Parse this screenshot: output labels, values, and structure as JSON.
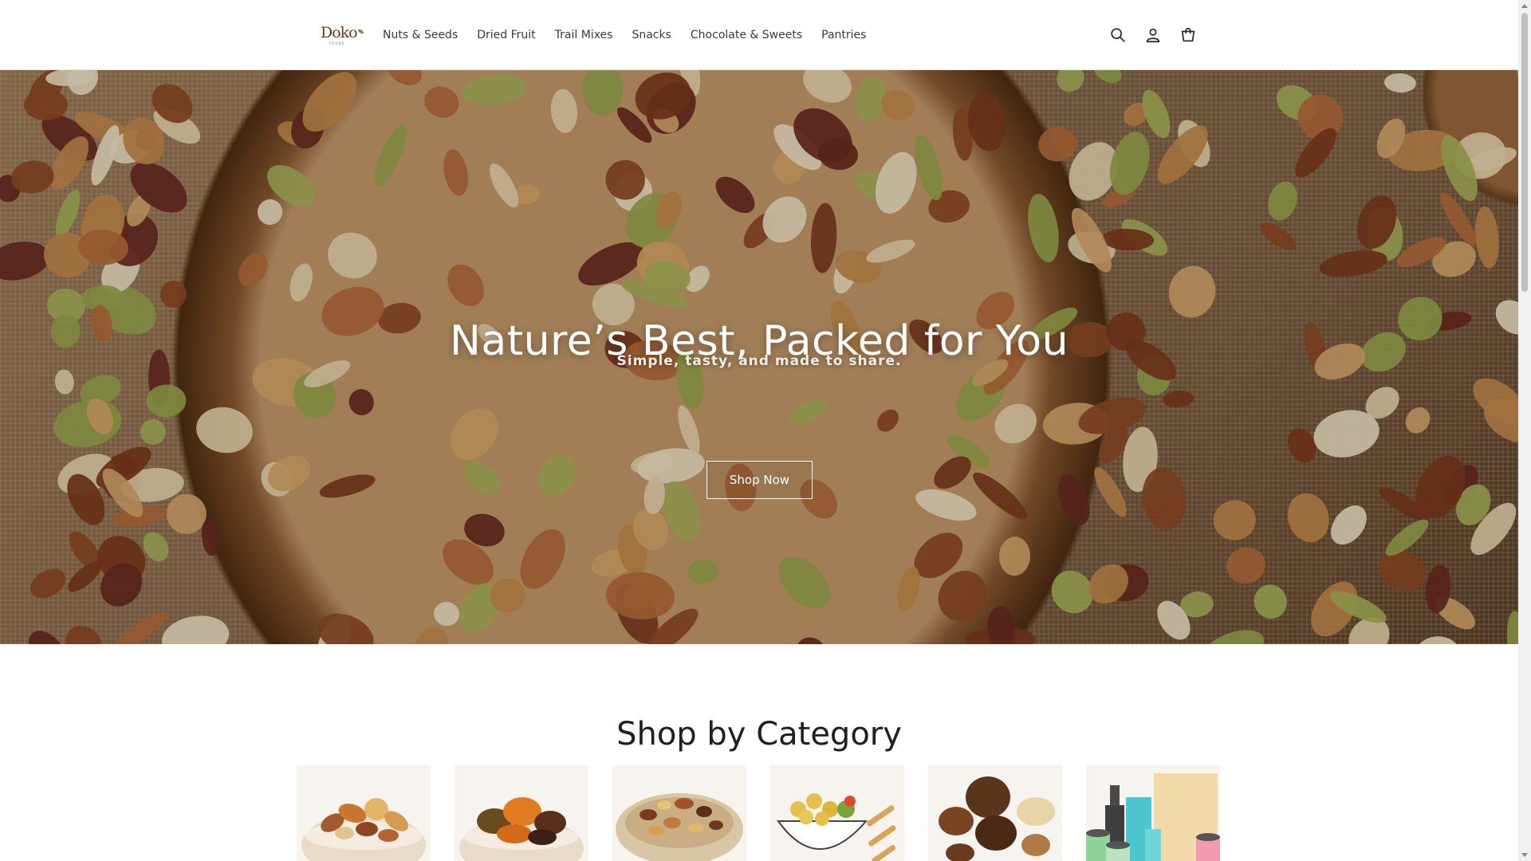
{
  "header": {
    "logo_text_main": "Doko",
    "logo_text_sub": "FOODS",
    "nav": [
      "Nuts & Seeds",
      "Dried Fruit",
      "Trail Mixes",
      "Snacks",
      "Chocolate & Sweets",
      "Pantries"
    ],
    "icons": [
      "search-icon",
      "account-icon",
      "cart-icon"
    ]
  },
  "hero": {
    "title": "Nature’s Best, Packed for You",
    "subtitle": "Simple, tasty, and made to share.",
    "button": "Shop Now"
  },
  "categories": {
    "title": "Shop by Category",
    "items": [
      {
        "icon": "mixed-nuts-bowl-icon"
      },
      {
        "icon": "dried-fruit-bowl-icon"
      },
      {
        "icon": "trail-mix-bowl-icon"
      },
      {
        "icon": "snacks-icon"
      },
      {
        "icon": "chocolate-sweets-icon"
      },
      {
        "icon": "pantry-items-icon"
      }
    ]
  },
  "colors": {
    "accent": "#d96a1b",
    "text": "#1f1f1f",
    "hero_overlay": "#6e4e33"
  }
}
